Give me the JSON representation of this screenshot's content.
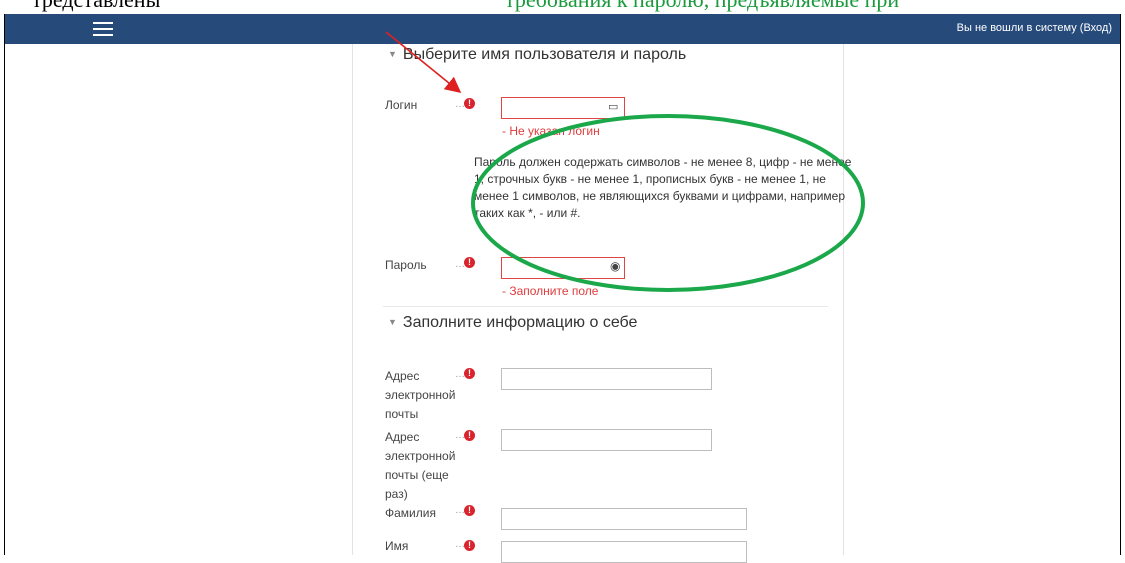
{
  "caption": {
    "left_fragment": "тредставлены",
    "middle_fragment": "требования к паролю, предъявляемые при",
    "color_black": "#000000",
    "color_green": "#1a9a3c"
  },
  "navbar": {
    "menu_icon": "hamburger-icon",
    "login_text": "Вы не вошли в систему (Вход)",
    "bg_color": "#264b7b"
  },
  "section_credentials": {
    "title": "Выберите имя пользователя и пароль",
    "login": {
      "label": "Логин",
      "value": "",
      "error": "- Не указан логин",
      "icon": "id-card-icon"
    },
    "password_policy": "Пароль должен содержать символов - не менее 8, цифр - не менее 1, строчных букв - не менее 1, прописных букв - не менее 1, не менее 1 символов, не являющихся буквами и цифрами, например таких как *, - или #.",
    "password": {
      "label": "Пароль",
      "value": "",
      "error": "- Заполните поле",
      "icon": "eye-icon"
    }
  },
  "section_profile": {
    "title": "Заполните информацию о себе",
    "fields": [
      {
        "label": "Адрес электронной почты",
        "value": ""
      },
      {
        "label": "Адрес электронной почты (еще раз)",
        "value": ""
      },
      {
        "label": "Фамилия",
        "value": ""
      },
      {
        "label": "Имя",
        "value": ""
      }
    ]
  },
  "required_icon": "required-exclamation-icon",
  "annotations": {
    "arrow_color": "#e02020",
    "ellipse_color": "#1aa84a"
  }
}
